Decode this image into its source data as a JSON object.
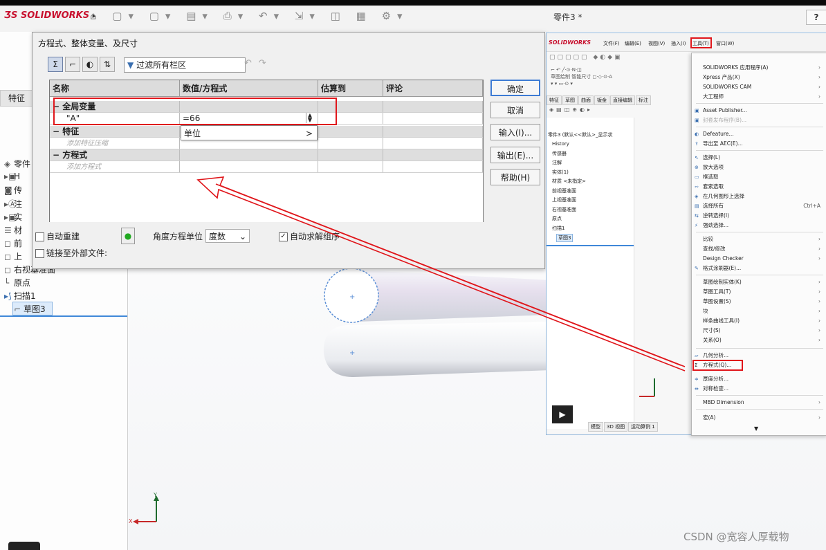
{
  "app": {
    "logo": "SOLIDWORKS",
    "doc_title": "零件3 *",
    "help": "?"
  },
  "left_panel": {
    "tab_label": "特征",
    "tree": [
      {
        "label": "零件",
        "icon": "part-icon"
      },
      {
        "label": "H",
        "icon": "history-icon"
      },
      {
        "label": "传",
        "icon": "sensor-icon"
      },
      {
        "label": "注",
        "icon": "annotation-icon"
      },
      {
        "label": "实",
        "icon": "solid-body-icon"
      },
      {
        "label": "材",
        "icon": "material-icon"
      },
      {
        "label": "前",
        "icon": "plane-icon"
      },
      {
        "label": "上",
        "icon": "plane-icon"
      },
      {
        "label": "右视基准面",
        "icon": "plane-icon"
      },
      {
        "label": "原点",
        "icon": "origin-icon"
      },
      {
        "label": "扫描1",
        "icon": "sweep-icon"
      },
      {
        "label": "草图3",
        "icon": "sketch-icon"
      }
    ]
  },
  "dialog": {
    "title": "方程式、整体变量、及尺寸",
    "filter_text": "过滤所有栏区",
    "columns": [
      "名称",
      "数值/方程式",
      "估算到",
      "评论"
    ],
    "section_global": "全局变量",
    "row_name": "\"A\"",
    "row_value": "=66",
    "unit_popup": "单位",
    "unit_popup_arrow": ">",
    "section_features": "特征",
    "hint_features": "添加特征压缩",
    "section_equations": "方程式",
    "hint_equations": "添加方程式",
    "buttons": {
      "ok": "确定",
      "cancel": "取消",
      "import": "输入(I)...",
      "export": "输出(E)...",
      "help": "帮助(H)"
    },
    "auto_rebuild": "自动重建",
    "angle_unit_label": "角度方程单位",
    "angle_unit_value": "度数",
    "auto_solve": "自动求解组序",
    "link_external": "链接至外部文件:"
  },
  "right_shot": {
    "logo": "SOLIDWORKS",
    "menus": [
      "文件(F)",
      "编辑(E)",
      "视图(V)",
      "插入(I)",
      "工具(T)",
      "窗口(W)"
    ],
    "tabs": [
      "特征",
      "草图",
      "曲面",
      "钣金",
      "直接编辑",
      "标注"
    ],
    "tree": [
      "零件3 (默认<<默认>_显示状",
      "History",
      "传感器",
      "注解",
      "实体(1)",
      "材质 <未指定>",
      "前视基准面",
      "上视基准面",
      "右视基准面",
      "原点",
      "扫描1",
      "草图3"
    ],
    "menu_items": [
      {
        "label": "SOLIDWORKS 应用程序(A)",
        "arrow": true
      },
      {
        "label": "Xpress 产品(X)",
        "arrow": true
      },
      {
        "label": "SOLIDWORKS CAM",
        "arrow": true
      },
      {
        "label": "大工程师",
        "arrow": true
      },
      {
        "label": "Asset Publisher...",
        "arrow": false
      },
      {
        "label": "封套发布程序(B)...",
        "arrow": false,
        "disabled": true
      },
      {
        "label": "Defeature...",
        "arrow": false
      },
      {
        "label": "导出至 AEC(E)...",
        "arrow": false
      },
      {
        "label": "选择(L)",
        "arrow": false
      },
      {
        "label": "放大选项",
        "arrow": false
      },
      {
        "label": "框选取",
        "arrow": false
      },
      {
        "label": "套索选取",
        "arrow": false
      },
      {
        "label": "在几何图形上选择",
        "arrow": false
      },
      {
        "label": "选择所有",
        "arrow": false,
        "shortcut": "Ctrl+A"
      },
      {
        "label": "逆转选择(I)",
        "arrow": false
      },
      {
        "label": "强劲选择...",
        "arrow": false
      },
      {
        "label": "比较",
        "arrow": true
      },
      {
        "label": "查找/修改",
        "arrow": true
      },
      {
        "label": "Design Checker",
        "arrow": true
      },
      {
        "label": "格式涂刷器(E)...",
        "arrow": false
      },
      {
        "label": "草图绘制实体(K)",
        "arrow": true
      },
      {
        "label": "草图工具(T)",
        "arrow": true
      },
      {
        "label": "草图设置(S)",
        "arrow": true
      },
      {
        "label": "块",
        "arrow": true
      },
      {
        "label": "样条曲线工具(I)",
        "arrow": true
      },
      {
        "label": "尺寸(S)",
        "arrow": true
      },
      {
        "label": "关系(O)",
        "arrow": true
      },
      {
        "label": "几何分析...",
        "arrow": false
      },
      {
        "label": "方程式(Q)...",
        "arrow": false
      },
      {
        "label": "厚度分析...",
        "arrow": false
      },
      {
        "label": "对称检查...",
        "arrow": false
      },
      {
        "label": "MBD Dimension",
        "arrow": true
      },
      {
        "label": "宏(A)",
        "arrow": true
      }
    ],
    "bottom_tabs": [
      "模型",
      "3D 视图",
      "运动算例 1"
    ]
  },
  "watermark": "CSDN @宽容人厚载物",
  "colors": {
    "highlight_red": "#e0161b",
    "brand_red": "#c8102e",
    "selection_blue": "#3d7bd4"
  }
}
